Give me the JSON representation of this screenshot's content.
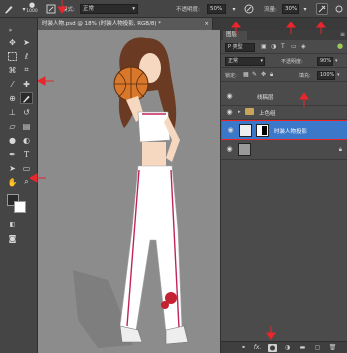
{
  "options_bar": {
    "brush_size": "1000",
    "mode_label": "模式:",
    "mode_value": "正常",
    "opacity_label": "不透明度:",
    "opacity_value": "50%",
    "flow_label": "流量:",
    "flow_value": "30%"
  },
  "document": {
    "tab_title": "时装人物.psd @ 18% (时装人物投影, RGB/8) *",
    "close": "×"
  },
  "layers_panel": {
    "tab_label": "图层",
    "kind_label": "P 类型",
    "blend_mode": "正常",
    "opacity_label": "不透明度:",
    "opacity_value": "90%",
    "lock_label": "锁定:",
    "fill_label": "填充:",
    "fill_value": "100%",
    "layers": [
      {
        "name": "线稿层",
        "type": "layer",
        "selected": false
      },
      {
        "name": "上色组",
        "type": "group",
        "selected": false
      },
      {
        "name": "时装人物投影",
        "type": "layer",
        "selected": true
      },
      {
        "name": "",
        "type": "background",
        "selected": false
      }
    ],
    "footer_fx": "fx."
  },
  "colors": {
    "annotation": "#e8262b",
    "selection": "#3b78c9",
    "panel_bg": "#4b4b4b",
    "canvas_bg": "#8c8c8c"
  }
}
